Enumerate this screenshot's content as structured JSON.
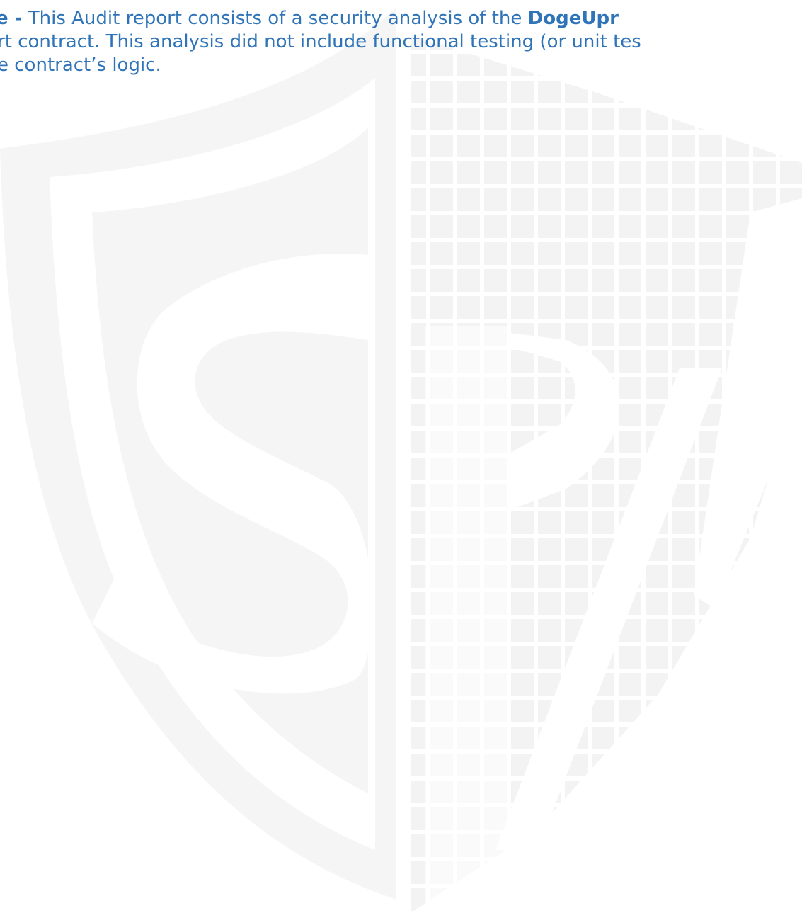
{
  "note": {
    "line1": {
      "lead_bold": "e -",
      "text": " This Audit report consists of a security analysis of the ",
      "project_bold": "DogeUpr"
    },
    "line2": "rt contract. This analysis did not include functional testing (or unit tes",
    "line3": "e contract’s logic."
  },
  "watermark": {
    "icon": "shield-sp-logo-icon",
    "color": "#f4f4f4"
  }
}
